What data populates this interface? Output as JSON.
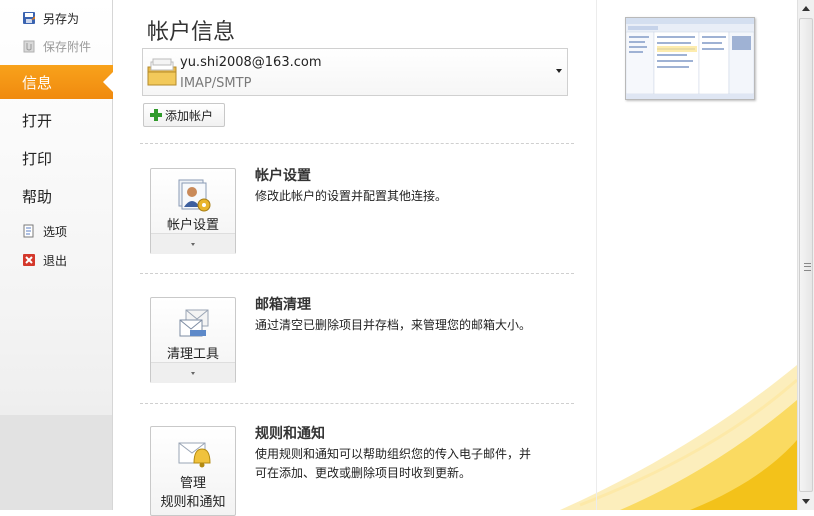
{
  "nav": {
    "save_as": "另存为",
    "save_attachments": "保存附件",
    "info": "信息",
    "open": "打开",
    "print": "打印",
    "help": "帮助",
    "options": "选项",
    "exit": "退出"
  },
  "main": {
    "title": "帐户信息",
    "account": {
      "email": "yu.shi2008@163.com",
      "type": "IMAP/SMTP"
    },
    "add_account_label": "添加帐户",
    "sections": [
      {
        "button_label": "帐户设置",
        "title": "帐户设置",
        "description": "修改此帐户的设置并配置其他连接。"
      },
      {
        "button_label": "清理工具",
        "title": "邮箱清理",
        "description": "通过清空已删除项目并存档，来管理您的邮箱大小。"
      },
      {
        "button_label_line1": "管理",
        "button_label_line2": "规则和通知",
        "title": "规则和通知",
        "description_line1": "使用规则和通知可以帮助组织您的传入电子邮件，并",
        "description_line2": "可在添加、更改或删除项目时收到更新。"
      }
    ]
  },
  "colors": {
    "accent": "#f39a16",
    "swoosh": "#f7c600"
  },
  "icons": [
    "save-as-icon",
    "attachment-icon",
    "options-icon",
    "exit-icon",
    "mail-folder-icon",
    "plus-icon",
    "account-settings-icon",
    "cleanup-tools-icon",
    "rules-alerts-icon"
  ]
}
